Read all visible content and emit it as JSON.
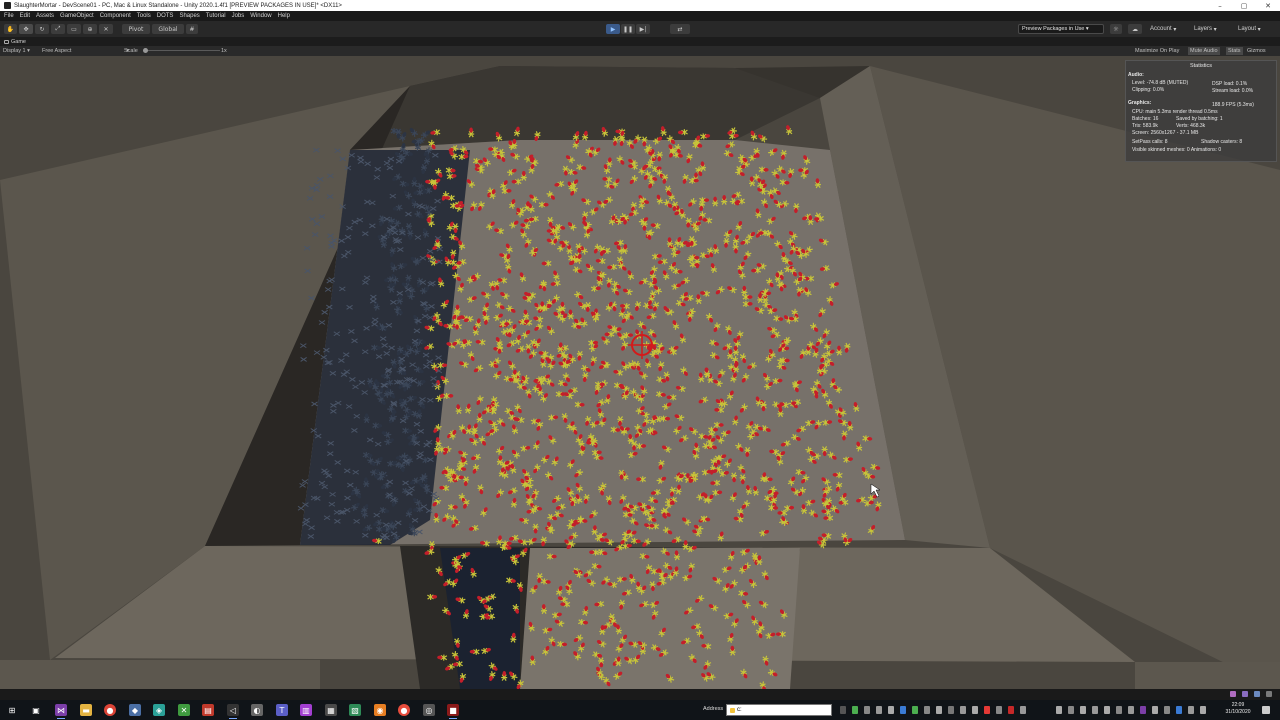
{
  "window": {
    "title": "SlaughterMortar - DevScene01 - PC, Mac & Linux Standalone - Unity 2020.1.4f1 [PREVIEW PACKAGES IN USE]* <DX11>",
    "controls": [
      "–",
      "▢",
      "✕"
    ]
  },
  "menu": {
    "items": [
      "File",
      "Edit",
      "Assets",
      "GameObject",
      "Component",
      "Tools",
      "DOTS",
      "Shapes",
      "Tutorial",
      "Jobs",
      "Window",
      "Help"
    ]
  },
  "toolbar": {
    "pivot_label": "Pivot",
    "global_label": "Global",
    "preview_packages": "Preview Packages in Use",
    "account": "Account",
    "layers": "Layers",
    "layout": "Layout",
    "accent_play": "#3a5a8a"
  },
  "game_view": {
    "tab_label": "Game",
    "display": "Display 1",
    "aspect": "Free Aspect",
    "scale_label": "Scale",
    "scale_value": "1x",
    "maximize_on_play": "Maximize On Play",
    "mute_audio": "Mute Audio",
    "stats": "Stats",
    "gizmos": "Gizmos"
  },
  "statistics": {
    "title": "Statistics",
    "audio_header": "Audio:",
    "level": "Level: -74.8 dB (MUTED)",
    "clipping": "Clipping: 0.0%",
    "dsp_load": "DSP load: 0.1%",
    "stream_load": "Stream load: 0.0%",
    "graphics_header": "Graphics:",
    "fps": "188.9 FPS (5.3ms)",
    "cpu": "CPU: main 5.3ms  render thread 0.5ms",
    "batches": "Batches: 16",
    "saved_batching": "Saved by batching: 1",
    "tris": "Tris: 583.9k",
    "verts": "Verts: 468.3k",
    "screen": "Screen: 2560x1267 - 37.1 MB",
    "setpass": "SetPass calls: 8",
    "shadow_casters": "Shadow casters: 8",
    "skinned": "Visible skinned meshes: 0  Animations: 0"
  },
  "taskbar": {
    "address_label": "Address",
    "address_value": "c:",
    "time": "22:09",
    "date": "31/10/2020"
  }
}
